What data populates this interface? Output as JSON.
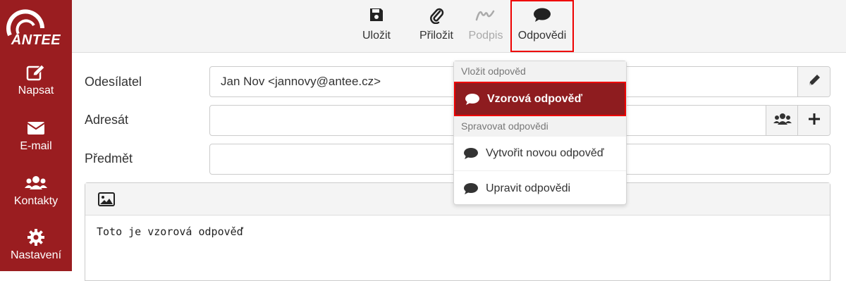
{
  "colors": {
    "brand": "#9a1d20",
    "highlight": "#e00000"
  },
  "logo": {
    "text": "ANTEE"
  },
  "sidebar": {
    "items": [
      {
        "label": "Napsat",
        "icon": "pencil-square-icon"
      },
      {
        "label": "E-mail",
        "icon": "envelope-icon"
      },
      {
        "label": "Kontakty",
        "icon": "users-icon"
      },
      {
        "label": "Nastavení",
        "icon": "gear-icon"
      }
    ]
  },
  "toolbar": {
    "save_label": "Uložit",
    "attach_label": "Přiložit",
    "sign_label": "Podpis",
    "responses_label": "Odpovědi"
  },
  "form": {
    "sender_label": "Odesílatel",
    "sender_value": "Jan Nov <jannovy@antee.cz>",
    "recipient_label": "Adresát",
    "recipient_value": "",
    "subject_label": "Předmět",
    "subject_value": ""
  },
  "editor": {
    "body": "Toto je vzorová odpověď"
  },
  "responses_menu": {
    "insert_header": "Vložit odpověd",
    "insert_items": [
      {
        "label": "Vzorová odpověď",
        "selected": true
      }
    ],
    "manage_header": "Spravovat odpovědi",
    "manage_items": [
      {
        "label": "Vytvořit novou odpověď"
      },
      {
        "label": "Upravit odpovědi"
      }
    ]
  }
}
